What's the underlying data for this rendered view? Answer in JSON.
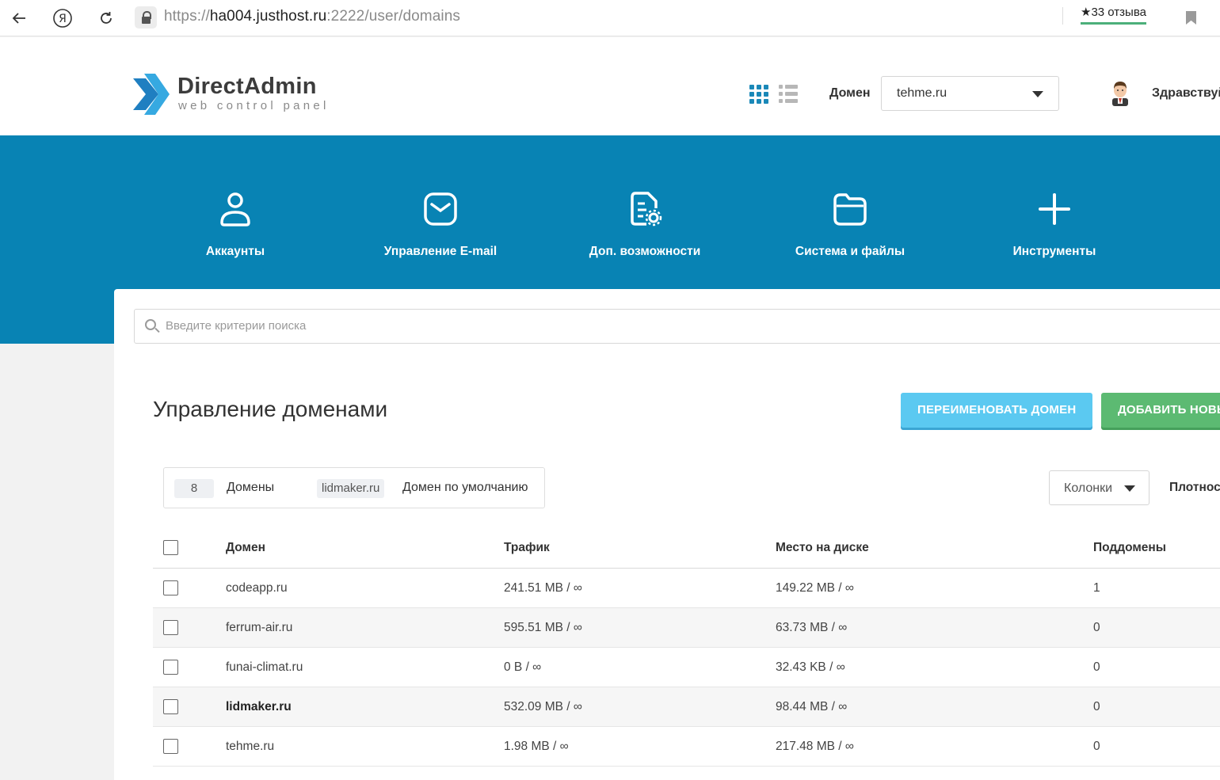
{
  "browser": {
    "url_prefix": "https://",
    "url_host": "ha004.justhost.ru",
    "url_path": ":2222/user/domains",
    "reviews": "★33 отзыва"
  },
  "header": {
    "logo_title": "DirectAdmin",
    "logo_subtitle": "web control panel",
    "domain_label": "Домен",
    "domain_value": "tehme.ru",
    "greeting": "Здравствуй"
  },
  "nav": {
    "items": [
      {
        "label": "Аккаунты",
        "icon": "user-icon"
      },
      {
        "label": "Управление E-mail",
        "icon": "mail-icon"
      },
      {
        "label": "Доп. возможности",
        "icon": "document-gear-icon"
      },
      {
        "label": "Система и файлы",
        "icon": "folder-icon"
      },
      {
        "label": "Инструменты",
        "icon": "plus-icon"
      }
    ]
  },
  "search": {
    "placeholder": "Введите критерии поиска"
  },
  "page": {
    "title": "Управление доменами",
    "rename_button": "ПЕРЕИМЕНОВАТЬ ДОМЕН",
    "add_button": "ДОБАВИТЬ НОВЫ"
  },
  "stats": {
    "count": "8",
    "count_label": "Домены",
    "default_domain": "lidmaker.ru",
    "default_label": "Домен по умолчанию"
  },
  "toolbar": {
    "columns_label": "Колонки",
    "density_label": "Плотнос"
  },
  "table": {
    "headers": [
      "Домен",
      "Трафик",
      "Место на диске",
      "Поддомены"
    ],
    "rows": [
      {
        "domain": "codeapp.ru",
        "traffic": "241.51 MB / ∞",
        "disk": "149.22 MB / ∞",
        "subdomains": "1",
        "default": false
      },
      {
        "domain": "ferrum-air.ru",
        "traffic": "595.51 MB / ∞",
        "disk": "63.73 MB / ∞",
        "subdomains": "0",
        "default": false
      },
      {
        "domain": "funai-climat.ru",
        "traffic": "0 B / ∞",
        "disk": "32.43 KB / ∞",
        "subdomains": "0",
        "default": false
      },
      {
        "domain": "lidmaker.ru",
        "traffic": "532.09 MB / ∞",
        "disk": "98.44 MB / ∞",
        "subdomains": "0",
        "default": true
      },
      {
        "domain": "tehme.ru",
        "traffic": "1.98 MB / ∞",
        "disk": "217.48 MB / ∞",
        "subdomains": "0",
        "default": false
      }
    ]
  },
  "colors": {
    "primary_blue": "#0883b4",
    "rename_button": "#5bc9f1",
    "add_button": "#5cba72"
  }
}
